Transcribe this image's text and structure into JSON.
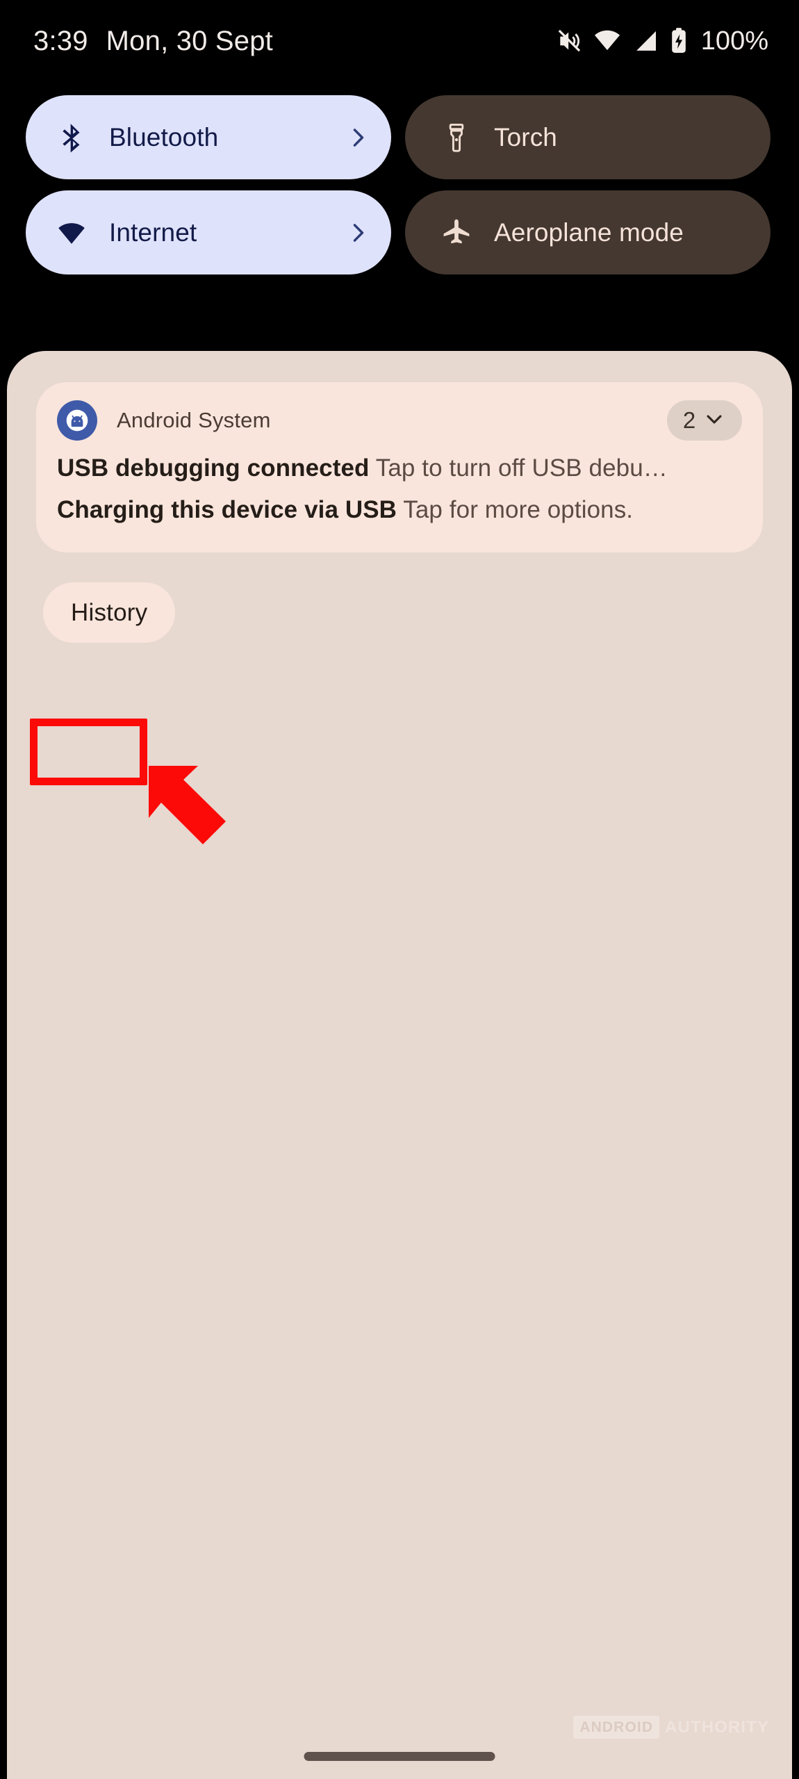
{
  "status_bar": {
    "time": "3:39",
    "date": "Mon, 30 Sept",
    "battery_percent": "100%",
    "icons": [
      "mute-icon",
      "wifi-icon",
      "signal-icon",
      "battery-charging-icon"
    ]
  },
  "quick_settings": {
    "tiles": [
      {
        "label": "Bluetooth",
        "icon": "bluetooth-icon",
        "state": "on",
        "has_chevron": true,
        "bg": "#dfe2fb",
        "fg": "#121b48"
      },
      {
        "label": "Torch",
        "icon": "flashlight-icon",
        "state": "off",
        "has_chevron": false,
        "bg": "#443830",
        "fg": "#f5e2d8"
      },
      {
        "label": "Internet",
        "icon": "wifi-icon",
        "state": "on",
        "has_chevron": true,
        "bg": "#dfe2fb",
        "fg": "#121b48"
      },
      {
        "label": "Aeroplane mode",
        "icon": "aeroplane-icon",
        "state": "off",
        "has_chevron": false,
        "bg": "#443830",
        "fg": "#f5e2d8"
      }
    ]
  },
  "shade": {
    "background": "#e7d8d0",
    "notification": {
      "app_name": "Android System",
      "app_icon": "android-system-icon",
      "expand_count": "2",
      "expand_icon": "chevron-down-icon",
      "card_background": "#f9e5dc",
      "lines": [
        {
          "title": "USB debugging connected",
          "body": "Tap to turn off USB debu…"
        },
        {
          "title": "Charging this device via USB",
          "body": "Tap for more options."
        }
      ]
    },
    "history_button": {
      "label": "History"
    }
  },
  "annotations": {
    "highlight_color": "#fb0a08",
    "arrow_color": "#fb0a08",
    "target": "History"
  },
  "watermark": {
    "box_text": "ANDROID",
    "text": "AUTHORITY"
  }
}
